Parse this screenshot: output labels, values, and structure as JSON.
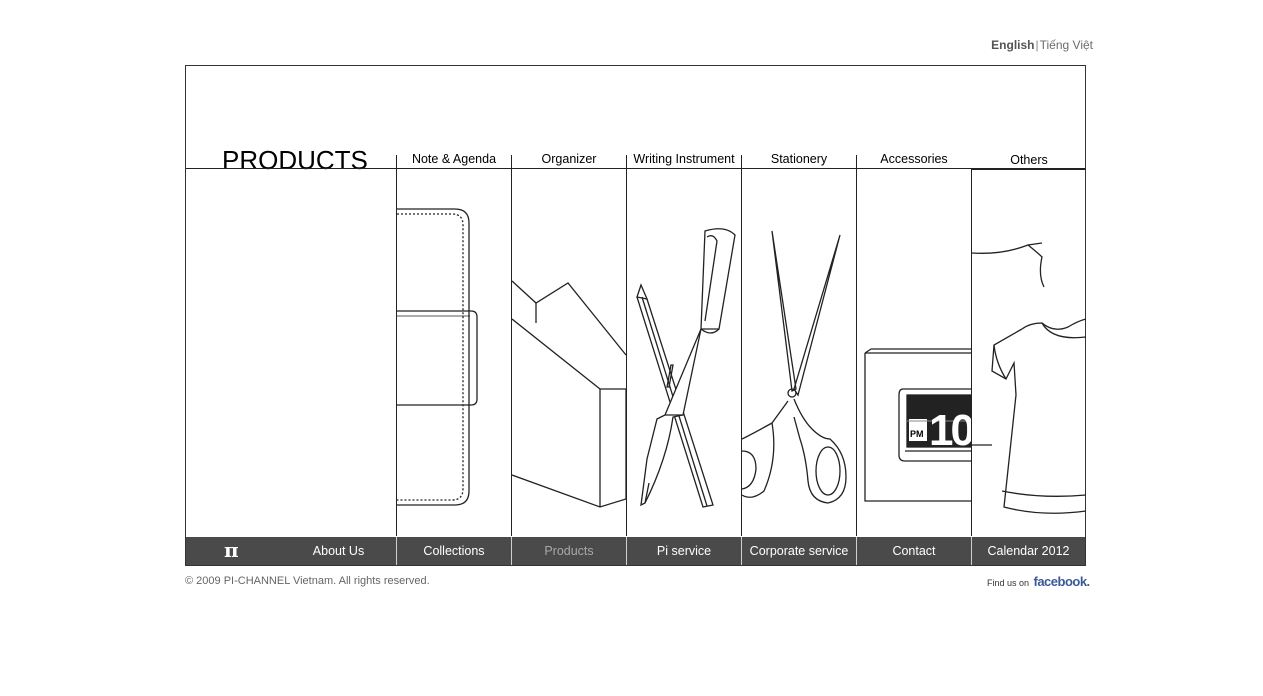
{
  "language": {
    "active": "English",
    "separator": "|",
    "alternate": "Tiếng Việt"
  },
  "page_title": "PRODUCTS",
  "categories": [
    {
      "label": "Note & Agenda",
      "image": "notebook-illustration"
    },
    {
      "label": "Organizer",
      "image": "magazine-holder-illustration"
    },
    {
      "label": "Writing Instrument",
      "image": "pen-pencil-illustration"
    },
    {
      "label": "Stationery",
      "image": "scissors-illustration"
    },
    {
      "label": "Accessories",
      "image": "flip-clock-illustration"
    },
    {
      "label": "Others",
      "image": "tshirt-illustration"
    }
  ],
  "clock_text": {
    "period": "PM",
    "digits": "10"
  },
  "nav": {
    "logo": "π",
    "items": [
      "About Us",
      "Collections",
      "Products",
      "Pi service",
      "Corporate service",
      "Contact",
      "Calendar 2012"
    ],
    "active": "Products"
  },
  "footer": {
    "copyright": "© 2009 PI-CHANNEL Vietnam. All rights reserved.",
    "find_us": "Find us on",
    "facebook": "facebook."
  },
  "colors": {
    "navbar": "#4a4a4a",
    "facebook": "#3b5998",
    "inactive_nav": "#a8a8a8"
  }
}
